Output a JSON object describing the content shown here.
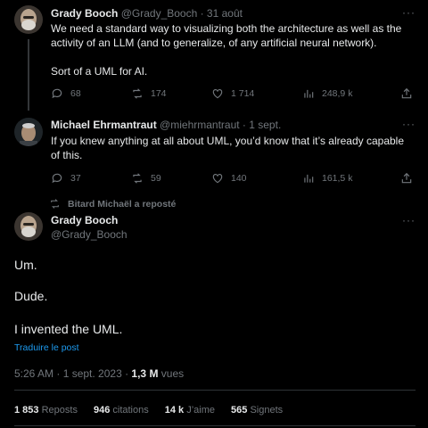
{
  "tweet1": {
    "name": "Grady Booch",
    "meta": "@Grady_Booch · 31 août",
    "more": "···",
    "line1": "We need a standard way to visualizing both the architecture as well as the",
    "line2": "activity of an LLM (and to generalize, of any artificial neural network).",
    "line3": "Sort of a UML for AI.",
    "replies": "68",
    "reposts": "174",
    "likes": "1 714",
    "views": "248,9 k"
  },
  "tweet2": {
    "name": "Michael Ehrmantraut",
    "meta": "@miehrmantraut · 1 sept.",
    "more": "···",
    "line1": "If you knew anything at all about UML, you’d know that it’s already capable",
    "line2": "of this.",
    "replies": "37",
    "reposts": "59",
    "likes": "140",
    "views": "161,5 k"
  },
  "repost_note": "Bitard Michaël a reposté",
  "main": {
    "name": "Grady Booch",
    "handle": "@Grady_Booch",
    "more": "···",
    "line1": "Um.",
    "line2": "Dude.",
    "line3": "I invented the UML.",
    "translate": "Traduire le post",
    "time": "5:26 AM · 1 sept. 2023 · ",
    "views_count": "1,3 M",
    "views_label": " vues",
    "stats": {
      "reposts_count": "1 853",
      "reposts_label": "Reposts",
      "quotes_count": "946",
      "quotes_label": "citations",
      "likes_count": "14 k",
      "likes_label": "J’aime",
      "bookmarks_count": "565",
      "bookmarks_label": "Signets"
    }
  },
  "colors": {
    "background": "#000000",
    "text": "#e7e9ea",
    "secondary": "#71767b",
    "link": "#1d9bf0"
  }
}
